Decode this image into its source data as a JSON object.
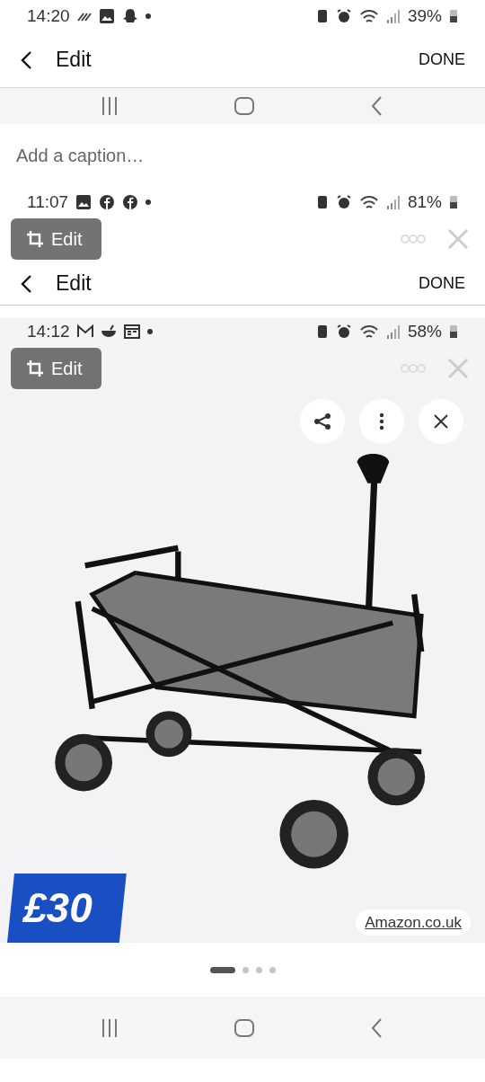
{
  "status_bar": {
    "time": "14:20",
    "battery": "39%"
  },
  "header": {
    "title": "Edit",
    "action": "DONE"
  },
  "caption": {
    "placeholder": "Add a caption…"
  },
  "nested_screen_1": {
    "status_bar": {
      "time": "11:07",
      "battery": "81%"
    },
    "edit_chip": "Edit",
    "header": {
      "title": "Edit",
      "action": "DONE"
    }
  },
  "nested_screen_2": {
    "status_bar": {
      "time": "14:12",
      "battery": "58%"
    },
    "edit_chip": "Edit",
    "product": {
      "price": "£30",
      "source": "Amazon.co.uk"
    }
  },
  "page_indicator": [
    {
      "selected": true
    },
    {
      "selected": false
    },
    {
      "selected": false
    },
    {
      "selected": false
    }
  ]
}
